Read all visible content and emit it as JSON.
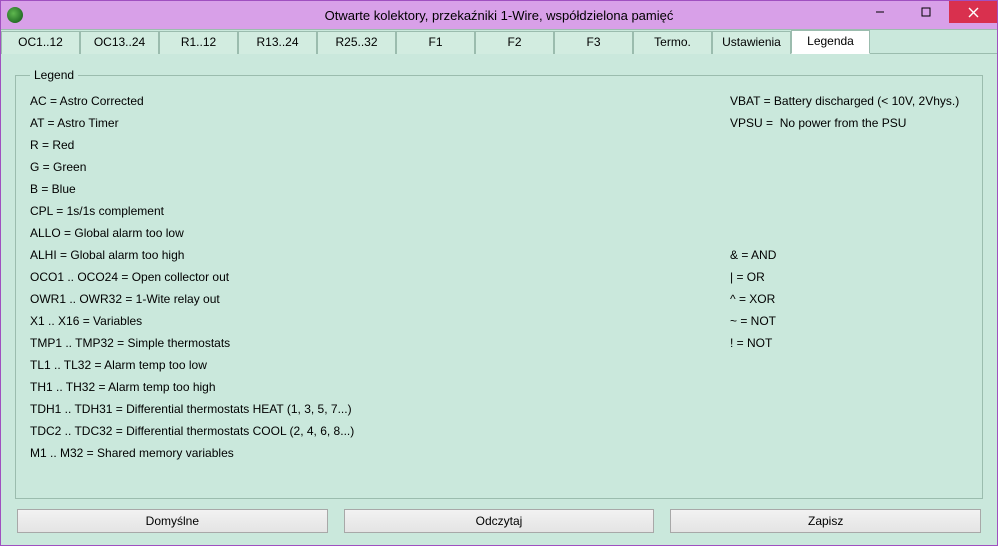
{
  "window": {
    "title": "Otwarte kolektory, przekaźniki 1-Wire, współdzielona pamięć"
  },
  "tabs": [
    {
      "label": "OC1..12"
    },
    {
      "label": "OC13..24"
    },
    {
      "label": "R1..12"
    },
    {
      "label": "R13..24"
    },
    {
      "label": "R25..32"
    },
    {
      "label": "F1"
    },
    {
      "label": "F2"
    },
    {
      "label": "F3"
    },
    {
      "label": "Termo."
    },
    {
      "label": "Ustawienia"
    },
    {
      "label": "Legenda"
    }
  ],
  "active_tab": 10,
  "legend": {
    "title": "Legend",
    "left": [
      "AC = Astro Corrected",
      "AT = Astro Timer",
      "R = Red",
      "G = Green",
      "B = Blue",
      "CPL = 1s/1s complement",
      "ALLO = Global alarm too low",
      "ALHI = Global alarm too high",
      "OCO1 .. OCO24 = Open collector out",
      "OWR1 .. OWR32 = 1-Wite relay out",
      "X1 .. X16 = Variables",
      "TMP1 .. TMP32 = Simple thermostats",
      "TL1 .. TL32 = Alarm temp too low",
      "TH1 .. TH32 = Alarm temp too high",
      "TDH1 .. TDH31 = Differential thermostats HEAT (1, 3, 5, 7...)",
      "TDC2 .. TDC32 = Differential thermostats COOL (2, 4, 6, 8...)",
      "M1 .. M32 = Shared memory variables"
    ],
    "right_top": [
      "VBAT = Battery discharged (< 10V, 2Vhys.)",
      "VPSU =  No power from the PSU"
    ],
    "right_ops": [
      "& = AND",
      "| = OR",
      "^ = XOR",
      "~ = NOT",
      "! = NOT"
    ]
  },
  "buttons": {
    "default": "Domyślne",
    "read": "Odczytaj",
    "save": "Zapisz"
  }
}
